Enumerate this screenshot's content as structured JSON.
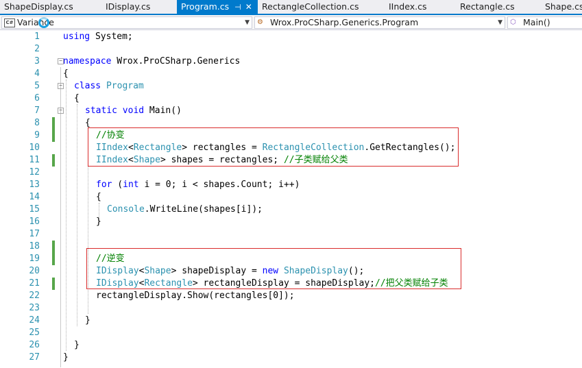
{
  "tabs": [
    {
      "label": "ShapeDisplay.cs",
      "active": false
    },
    {
      "label": "IDisplay.cs",
      "active": false
    },
    {
      "label": "Program.cs",
      "active": true
    },
    {
      "label": "RectangleCollection.cs",
      "active": false
    },
    {
      "label": "IIndex.cs",
      "active": false
    },
    {
      "label": "Rectangle.cs",
      "active": false
    },
    {
      "label": "Shape.cs",
      "active": false
    }
  ],
  "navbar": {
    "project": "Variance",
    "class_scope": "Wrox.ProCSharp.Generics.Program",
    "member": "Main()"
  },
  "code_lines": [
    {
      "n": "1",
      "tokens": [
        [
          "kw",
          "using"
        ],
        [
          "",
          "System;"
        ]
      ]
    },
    {
      "n": "2",
      "tokens": []
    },
    {
      "n": "3",
      "tokens": [
        [
          "kw",
          "namespace"
        ],
        [
          "",
          " Wrox.ProCSharp.Generics"
        ]
      ]
    },
    {
      "n": "4",
      "tokens": [
        [
          "",
          "{"
        ]
      ]
    },
    {
      "n": "5",
      "tokens": [
        [
          "kw",
          "class"
        ],
        [
          "",
          " "
        ],
        [
          "ty",
          "Program"
        ]
      ]
    },
    {
      "n": "6",
      "tokens": [
        [
          "",
          "{"
        ]
      ]
    },
    {
      "n": "7",
      "tokens": [
        [
          "kw",
          "static"
        ],
        [
          "",
          " "
        ],
        [
          "kw",
          "void"
        ],
        [
          "",
          " Main()"
        ]
      ]
    },
    {
      "n": "8",
      "tokens": [
        [
          "",
          "{"
        ]
      ]
    },
    {
      "n": "9",
      "tokens": [
        [
          "cm",
          "//协变"
        ]
      ]
    },
    {
      "n": "10",
      "tokens": [
        [
          "ty",
          "IIndex"
        ],
        [
          "",
          "<"
        ],
        [
          "ty",
          "Rectangle"
        ],
        [
          "",
          "> rectangles = "
        ],
        [
          "ty",
          "RectangleCollection"
        ],
        [
          "",
          ".GetRectangles();"
        ]
      ]
    },
    {
      "n": "11",
      "tokens": [
        [
          "ty",
          "IIndex"
        ],
        [
          "",
          "<"
        ],
        [
          "ty",
          "Shape"
        ],
        [
          "",
          "> shapes = rectangles; "
        ],
        [
          "cm",
          "//子类赋给父类"
        ]
      ]
    },
    {
      "n": "12",
      "tokens": []
    },
    {
      "n": "13",
      "tokens": [
        [
          "kw",
          "for"
        ],
        [
          "",
          " ("
        ],
        [
          "kw",
          "int"
        ],
        [
          "",
          " i = 0; i < shapes.Count; i++)"
        ]
      ]
    },
    {
      "n": "14",
      "tokens": [
        [
          "",
          "{"
        ]
      ]
    },
    {
      "n": "15",
      "tokens": [
        [
          "ty",
          "Console"
        ],
        [
          "",
          ".WriteLine(shapes[i]);"
        ]
      ]
    },
    {
      "n": "16",
      "tokens": [
        [
          "",
          "}"
        ]
      ]
    },
    {
      "n": "17",
      "tokens": []
    },
    {
      "n": "18",
      "tokens": []
    },
    {
      "n": "19",
      "tokens": [
        [
          "cm",
          "//逆变"
        ]
      ]
    },
    {
      "n": "20",
      "tokens": [
        [
          "ty",
          "IDisplay"
        ],
        [
          "",
          "<"
        ],
        [
          "ty",
          "Shape"
        ],
        [
          "",
          "> shapeDisplay = "
        ],
        [
          "kw",
          "new"
        ],
        [
          "",
          " "
        ],
        [
          "ty",
          "ShapeDisplay"
        ],
        [
          "",
          "();"
        ]
      ]
    },
    {
      "n": "21",
      "tokens": [
        [
          "ty",
          "IDisplay"
        ],
        [
          "",
          "<"
        ],
        [
          "ty",
          "Rectangle"
        ],
        [
          "",
          "> rectangleDisplay = shapeDisplay;"
        ],
        [
          "cm",
          "//把父类赋给子类"
        ]
      ]
    },
    {
      "n": "22",
      "tokens": [
        [
          "",
          "rectangleDisplay.Show(rectangles[0]);"
        ]
      ]
    },
    {
      "n": "23",
      "tokens": []
    },
    {
      "n": "24",
      "tokens": [
        [
          "",
          "}"
        ]
      ]
    },
    {
      "n": "25",
      "tokens": []
    },
    {
      "n": "26",
      "tokens": [
        [
          "",
          "}"
        ]
      ]
    },
    {
      "n": "27",
      "tokens": [
        [
          "",
          "}"
        ]
      ]
    }
  ],
  "colors": {
    "keyword": "#0000ff",
    "type": "#2b91af",
    "comment": "#008000",
    "line_number": "#2b91af",
    "change_marker": "#57a64a",
    "highlight_box": "#d92b2b",
    "active_tab": "#007acc"
  },
  "icons": {
    "project_icon": "csharp-project-icon",
    "class_icon": "class-icon",
    "member_icon": "method-icon"
  }
}
